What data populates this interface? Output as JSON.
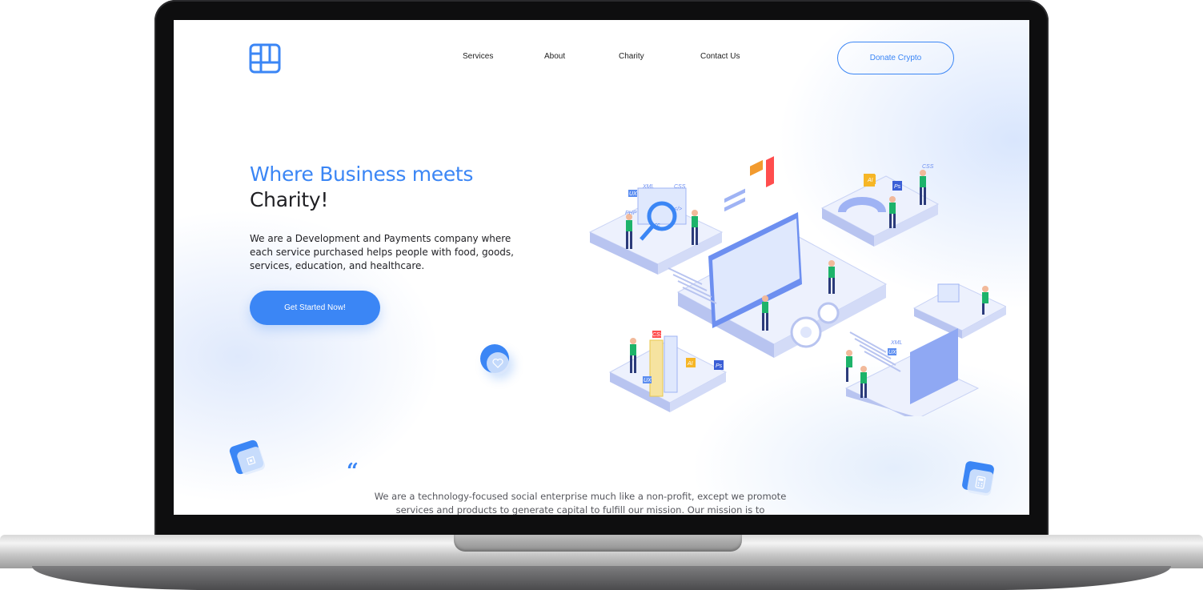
{
  "nav": {
    "links": [
      "Services",
      "About",
      "Charity",
      "Contact Us"
    ],
    "cta_label": "Donate Crypto"
  },
  "hero": {
    "title_line1": "Where Business meets",
    "title_line2": "Charity!",
    "description": "We are a Development and Payments company where each service purchased helps people with food, goods, services, education, and healthcare.",
    "button_label": "Get Started Now!"
  },
  "quote": {
    "mark": "“",
    "text": "We are a technology-focused social enterprise much like a non-profit, except we promote services and products to generate capital to fulfill our mission. Our mission is to"
  },
  "illustration": {
    "tags": [
      "UX",
      "XML",
      "CSS",
      "PHP",
      "</>",
      "<c",
      "AI",
      "Ps",
      "CSS",
      "UX",
      "XML",
      "CSS",
      "AI",
      "Ps",
      "UX"
    ]
  },
  "colors": {
    "accent": "#3b86f5",
    "text_dark": "#1f1f23",
    "text_muted": "#55565c"
  }
}
